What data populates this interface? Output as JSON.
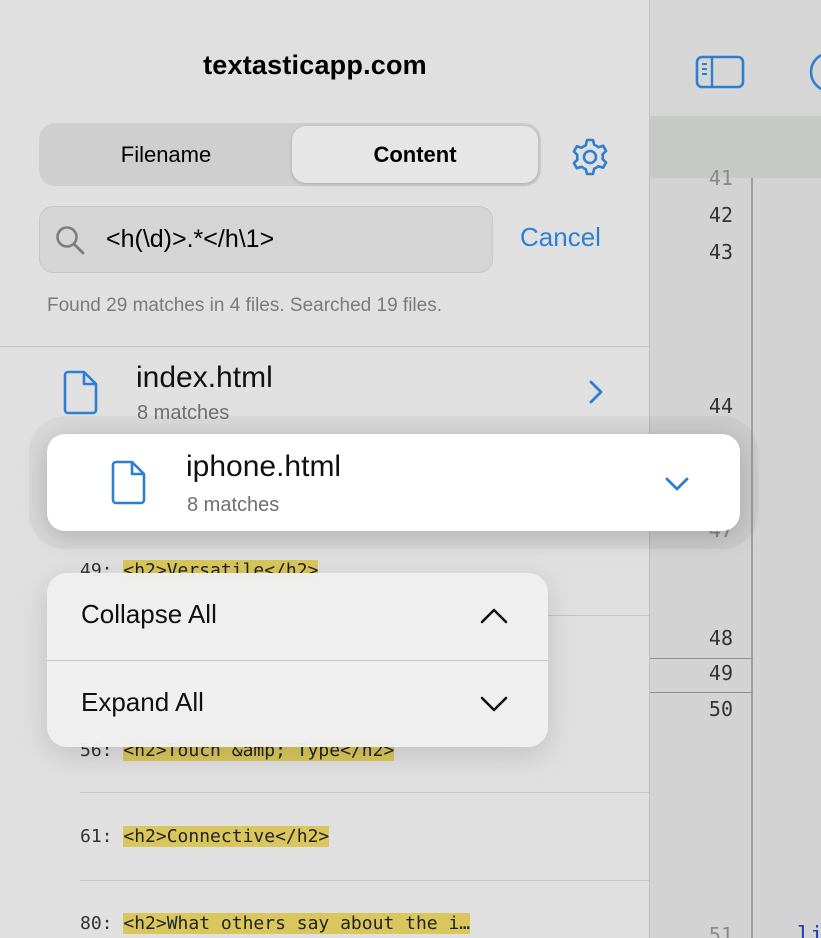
{
  "sidebar": {
    "title": "textasticapp.com",
    "segments": {
      "filename": "Filename",
      "content": "Content"
    },
    "search": {
      "query": "<h(\\d)>.*</h\\1>",
      "cancel": "Cancel"
    },
    "summary": "Found 29 matches in 4 files. Searched 19 files.",
    "files": [
      {
        "name": "index.html",
        "count": "8 matches"
      },
      {
        "name": "iphone.html",
        "count": "8 matches"
      }
    ],
    "matches": [
      {
        "line": "49:",
        "code": "<h2>Versatile</h2>"
      },
      {
        "line": "56:",
        "code": "<h2>Touch &amp; Type</h2>"
      },
      {
        "line": "61:",
        "code": "<h2>Connective</h2>"
      },
      {
        "line": "80:",
        "code": "<h2>What others say about the i…"
      }
    ]
  },
  "context_menu": {
    "items": [
      {
        "label": "Collapse All",
        "icon": "chevron-up-icon"
      },
      {
        "label": "Expand All",
        "icon": "chevron-down-icon"
      }
    ]
  },
  "editor": {
    "line_numbers": [
      "41",
      "42",
      "43",
      "44",
      "47",
      "48",
      "49",
      "50",
      "51"
    ],
    "code_fragment": "li"
  },
  "colors": {
    "accent": "#2f7fd0",
    "highlight": "#d9c75d",
    "sidebar_bg": "#e0e0e0",
    "card_bg": "#ffffff"
  }
}
